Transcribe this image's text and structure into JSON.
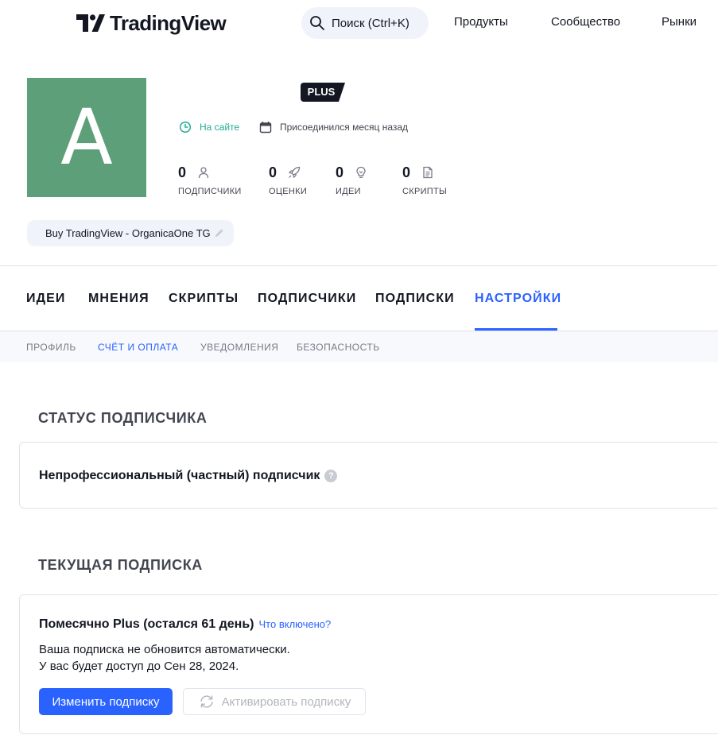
{
  "header": {
    "logo_text": "TradingView",
    "search_label": "Поиск (Ctrl+K)",
    "nav": [
      "Продукты",
      "Сообщество",
      "Рынки"
    ]
  },
  "profile": {
    "avatar_letter": "A",
    "plan_badge": "PLUS",
    "online_status": "На сайте",
    "joined": "Присоединился месяц назад",
    "stats": [
      {
        "count": "0",
        "label": "ПОДПИСЧИКИ",
        "icon": "user-icon"
      },
      {
        "count": "0",
        "label": "ОЦЕНКИ",
        "icon": "rocket-icon"
      },
      {
        "count": "0",
        "label": "ИДЕИ",
        "icon": "lightbulb-icon"
      },
      {
        "count": "0",
        "label": "СКРИПТЫ",
        "icon": "script-icon"
      }
    ],
    "bio": "Buy TradingView - OrganicaOne TG"
  },
  "tabs": [
    "ИДЕИ",
    "МНЕНИЯ",
    "СКРИПТЫ",
    "ПОДПИСЧИКИ",
    "ПОДПИСКИ",
    "НАСТРОЙКИ"
  ],
  "active_tab": "НАСТРОЙКИ",
  "subtabs": [
    "ПРОФИЛЬ",
    "СЧЁТ И ОПЛАТА",
    "УВЕДОМЛЕНИЯ",
    "БЕЗОПАСНОСТЬ"
  ],
  "active_subtab": "СЧЁТ И ОПЛАТА",
  "subscriber_status": {
    "title": "СТАТУС ПОДПИСЧИКА",
    "value": "Непрофессиональный (частный) подписчик",
    "help_glyph": "?"
  },
  "current_subscription": {
    "title": "ТЕКУЩАЯ ПОДПИСКА",
    "plan": "Помесячно Plus (остался 61 день)",
    "whats_included": "Что включено?",
    "line1": "Ваша подписка не обновится автоматически.",
    "line2": "У вас будет доступ до Сен 28, 2024.",
    "change_button": "Изменить подписку",
    "activate_button": "Активировать подписку"
  },
  "colors": {
    "accent": "#2962ff",
    "avatar_bg": "#5c9f79",
    "online": "#22ab94",
    "badge_bg": "#131722"
  }
}
